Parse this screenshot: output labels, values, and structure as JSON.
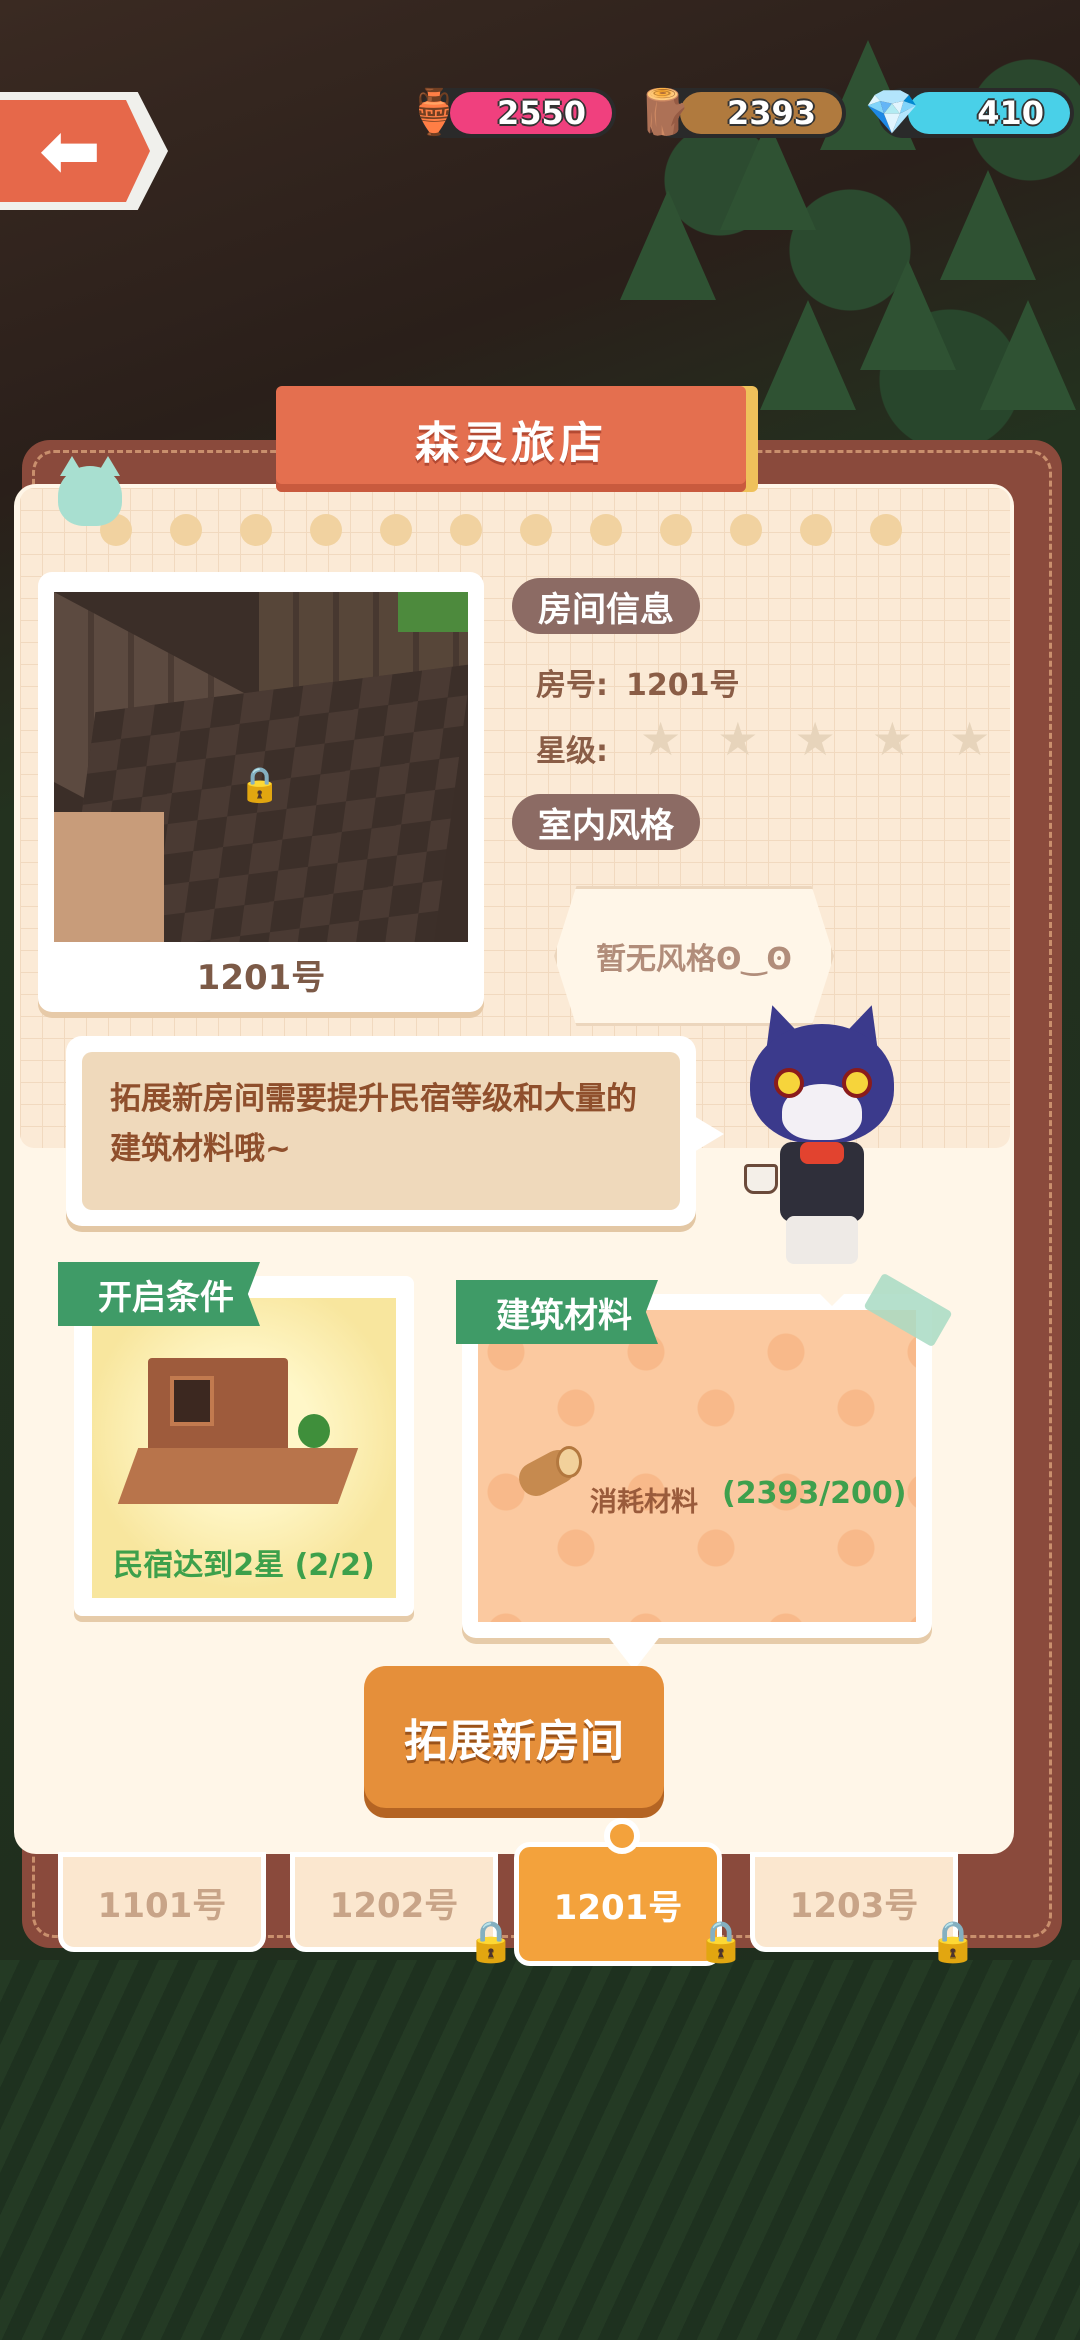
{
  "resources": {
    "potion": {
      "value": "2550",
      "icon": "potion-jar-icon",
      "color": "#f0407e"
    },
    "wood": {
      "value": "2393",
      "icon": "wood-log-icon",
      "color": "#b07a3e"
    },
    "gem": {
      "value": "410",
      "icon": "gem-icon",
      "color": "#49d0e8"
    }
  },
  "title": "森灵旅店",
  "room_info": {
    "tag": "房间信息",
    "room_number_label": "房号:",
    "room_number_value": "1201号",
    "star_label": "星级:",
    "stars_total": 5,
    "stars_filled": 0,
    "style_tag": "室内风格",
    "style_value": "暂无风格ʘ‿ʘ"
  },
  "room_preview": {
    "label": "1201号"
  },
  "speech": "拓展新房间需要提升民宿等级和大量的建筑材料哦~",
  "conditions": {
    "tag": "开启条件",
    "text": "民宿达到2星 (2/2)"
  },
  "materials": {
    "tag": "建筑材料",
    "label": "消耗材料",
    "value": "(2393/200)"
  },
  "expand_button": "拓展新房间",
  "tabs": [
    {
      "label": "1101号",
      "locked": false
    },
    {
      "label": "1202号",
      "locked": true
    },
    {
      "label": "1201号",
      "locked": true,
      "active": true
    },
    {
      "label": "1203号",
      "locked": true
    }
  ]
}
